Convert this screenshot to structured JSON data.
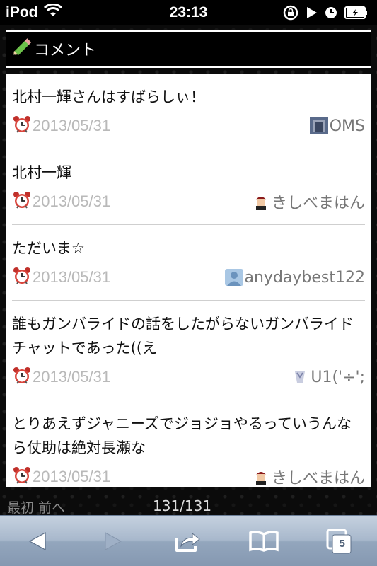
{
  "status_bar": {
    "carrier": "iPod",
    "time": "23:13"
  },
  "panel": {
    "title": "コメント"
  },
  "comments": [
    {
      "text": "北村一輝さんはすばらしぃ！",
      "date": "2013/05/31",
      "user": "OMS"
    },
    {
      "text": "北村一輝",
      "date": "2013/05/31",
      "user": "きしべまはん"
    },
    {
      "text": "ただいま☆",
      "date": "2013/05/31",
      "user": "anydaybest122"
    },
    {
      "text": "誰もガンバライドの話をしたがらないガンバライドチャットであった((え",
      "date": "2013/05/31",
      "user": "U1('÷';"
    },
    {
      "text": "とりあえずジャニーズでジョジョやるっていうんなら仗助は絶対長瀬な",
      "date": "2013/05/31",
      "user": "きしべまはん"
    }
  ],
  "pager": {
    "first": "最初",
    "prev": "前へ",
    "count": "131/131"
  },
  "toolbar": {
    "tab_count": "5"
  },
  "colors": {
    "panel_header_bg": "#000000",
    "date_text": "#b9b9b9",
    "username_text": "#777777"
  }
}
